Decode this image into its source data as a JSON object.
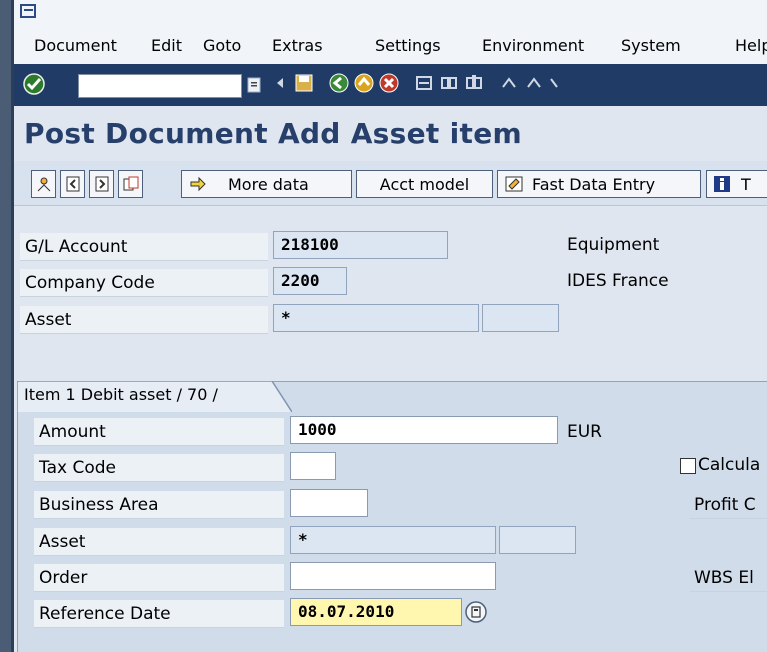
{
  "menu": [
    "Document",
    "Edit",
    "Goto",
    "Extras",
    "Settings",
    "Environment",
    "System",
    "Help"
  ],
  "menu_visible": [
    "Document",
    "Edit",
    "Goto",
    "Extras",
    "Settings",
    "Environment",
    "System",
    "Help"
  ],
  "command_field": {
    "value": ""
  },
  "title": "Post Document Add Asset item",
  "app_toolbar": {
    "more_data": "More data",
    "acct_model": "Acct model",
    "fast_data_entry": "Fast Data Entry",
    "truncated_button": "T"
  },
  "header": {
    "gl_account_label": "G/L Account",
    "gl_account_value": "218100",
    "gl_account_text": "Equipment",
    "company_code_label": "Company Code",
    "company_code_value": "2200",
    "company_code_text": "IDES France",
    "asset_label": "Asset",
    "asset_value": "*"
  },
  "item": {
    "tab_label": "Item 1 Debit asset / 70 /",
    "amount_label": "Amount",
    "amount_value": "1000",
    "currency": "EUR",
    "tax_code_label": "Tax Code",
    "calculate_label": "Calcula",
    "business_area_label": "Business Area",
    "profit_center_label": "Profit C",
    "asset_label": "Asset",
    "asset_value": "*",
    "order_label": "Order",
    "wbs_label": "WBS El",
    "reference_date_label": "Reference Date",
    "reference_date_value": "08.07.2010"
  },
  "colors": {
    "title": "#27406b",
    "toolbar": "#1f3b66",
    "required_field": "#fff7b0"
  }
}
